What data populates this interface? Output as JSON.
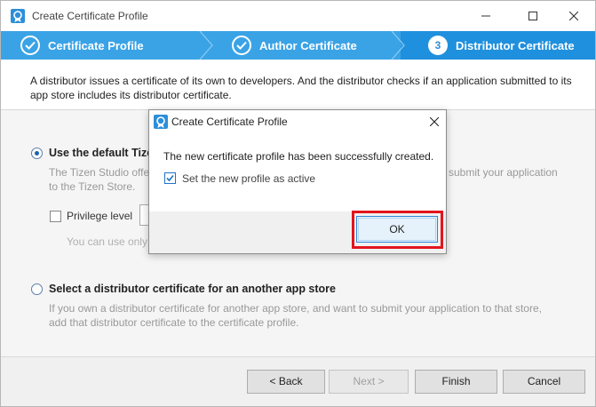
{
  "window": {
    "title": "Create Certificate Profile",
    "minimize_icon": "minimize-icon",
    "maximize_icon": "maximize-icon",
    "close_icon": "close-icon"
  },
  "wizard_steps": [
    {
      "label": "Certificate Profile",
      "state": "done",
      "icon": "check-circle-icon"
    },
    {
      "label": "Author Certificate",
      "state": "done",
      "icon": "check-circle-icon"
    },
    {
      "number": "3",
      "label": "Distributor Certificate",
      "state": "active"
    }
  ],
  "description": "A distributor issues a certificate of its own to developers. And the distributor checks if an application submitted to its app store includes its distributor certificate.",
  "option_default": {
    "label": "Use the default Tize",
    "desc_line1": "The Tizen Studio offe",
    "desc_line1_right": "submit your application",
    "desc_line2": "to the Tizen Store.",
    "privilege_label": "Privilege level",
    "hint": "You can use only",
    "selected": true
  },
  "option_other": {
    "label": "Select a distributor certificate for an another app store",
    "desc_line1": "If you own a distributor certificate for another app store, and want to submit your application to that store,",
    "desc_line2": "add that distributor certificate to the certificate profile.",
    "selected": false
  },
  "buttons": {
    "back": "< Back",
    "next": "Next >",
    "finish": "Finish",
    "cancel": "Cancel"
  },
  "dialog": {
    "title": "Create Certificate Profile",
    "message": "The new certificate profile has been successfully created.",
    "checkbox_label": "Set the new profile as active",
    "checkbox_checked": true,
    "ok_label": "OK"
  },
  "colors": {
    "wizard_bar": "#3aa3e6",
    "wizard_active": "#1f90dd",
    "highlight": "#e2151d"
  }
}
